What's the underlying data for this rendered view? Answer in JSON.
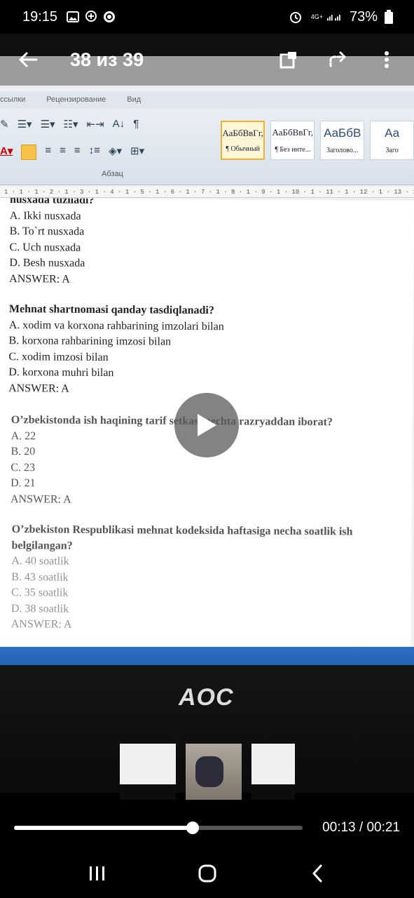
{
  "status_bar": {
    "time": "19:15",
    "network": "4G+",
    "battery": "73%"
  },
  "app_bar": {
    "counter": "38 из 39"
  },
  "word": {
    "tabs": [
      "ссылки",
      "Рецензирование",
      "Вид"
    ],
    "paragraph_label": "Абзац",
    "styles": [
      {
        "sample": "АаБбВвГг,",
        "name": "¶ Обычный"
      },
      {
        "sample": "АаБбВвГг,",
        "name": "¶ Без инте..."
      },
      {
        "sample": "АаБбВ",
        "name": "Заголово..."
      },
      {
        "sample": "Аа",
        "name": "Заго"
      }
    ],
    "ruler": "1 · 1 · 1 · 2 · 1 · 3 · 1 · 4 · 1 · 5 · 1 · 6 · 1 · 7 · 1 · 8 · 1 · 9 · 1 · 10 · 1 · 11 · 1 · 12 · 1 · 13 · 1 · 14"
  },
  "document": {
    "q0": {
      "title": "nusxada tuziladi?",
      "a": "A. Ikki nusxada",
      "b": "B. To`rt nusxada",
      "c": "C. Uch nusxada",
      "d": "D. Besh nusxada",
      "answer": "ANSWER: A"
    },
    "q1": {
      "title": "Mehnat shartnomasi qanday tasdiqlanadi?",
      "a": "A. xodim va korxona rahbarining imzolari bilan",
      "b": "B. korxona rahbarining imzosi bilan",
      "c": "C. xodim imzosi bilan",
      "d": "D. korxona muhri bilan",
      "answer": "ANSWER: A"
    },
    "q2": {
      "title": "O’zbekistonda ish haqining tarif setkasi nechta razryaddan iborat?",
      "a": "A. 22",
      "b": "B. 20",
      "c": "C. 23",
      "d": "D. 21",
      "answer": "ANSWER: A"
    },
    "q3": {
      "title": "O’zbekiston Respublikasi mehnat kodeksida haftasiga necha soatlik ish",
      "title2": "belgilangan?",
      "a": "A. 40 soatlik",
      "b": "B. 43 soatlik",
      "c": "C. 35 soatlik",
      "d": "D. 38 soatlik",
      "answer": "ANSWER: A"
    }
  },
  "monitor_brand": "AOC",
  "player": {
    "time": "00:13 / 00:21",
    "progress": 0.62
  }
}
